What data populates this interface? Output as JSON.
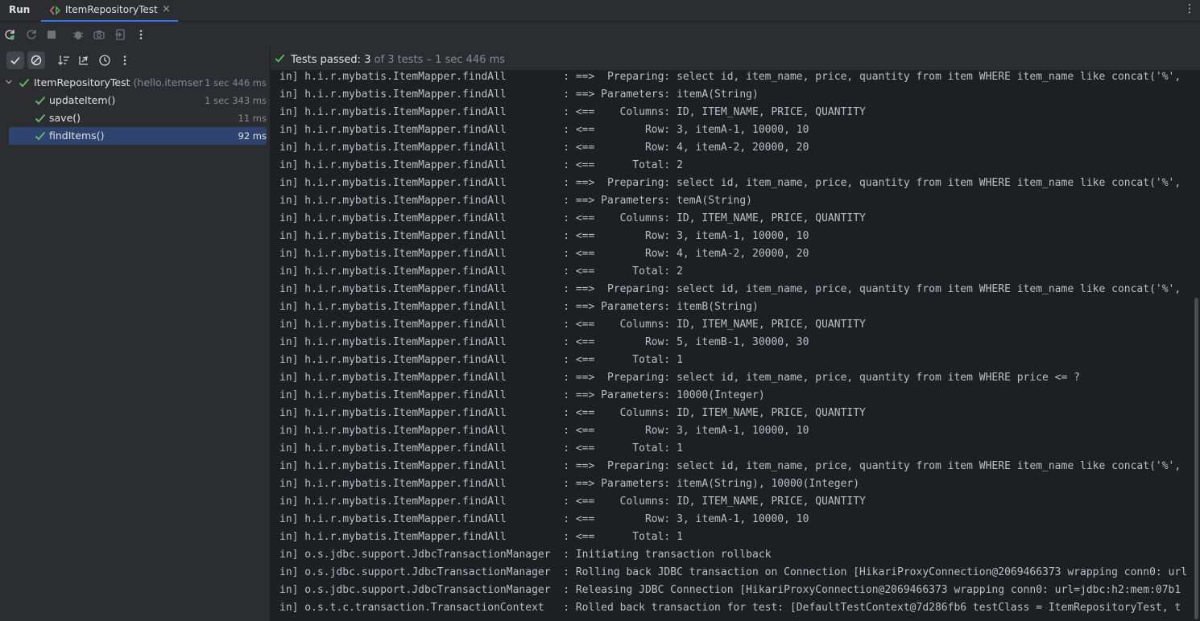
{
  "header": {
    "run_label": "Run",
    "tab_title": "ItemRepositoryTest",
    "tab_close": "×",
    "more_icon": "⋮"
  },
  "toolbar": {
    "icons": [
      "rerun-icon",
      "rerun-failed-icon",
      "stop-icon",
      "debug-icon",
      "screenshot-icon",
      "exit-icon",
      "more-icon"
    ]
  },
  "test_toolbar": {
    "icons": [
      "show-passed-icon",
      "show-ignored-icon",
      "sort-icon",
      "collapse-icon",
      "history-icon",
      "more-icon"
    ]
  },
  "status": {
    "label": "Tests passed:",
    "count": "3",
    "rest": "of 3 tests – 1 sec 446 ms"
  },
  "tree": {
    "root": {
      "name": "ItemRepositoryTest",
      "package": "(hello.itemser",
      "time": "1 sec 446 ms"
    },
    "children": [
      {
        "name": "updateItem()",
        "time": "1 sec 343 ms"
      },
      {
        "name": "save()",
        "time": "11 ms"
      },
      {
        "name": "findItems()",
        "time": "92 ms"
      }
    ]
  },
  "console": {
    "lines": [
      "in] h.i.r.mybatis.ItemMapper.findAll         : ==>  Preparing: select id, item_name, price, quantity from item WHERE item_name like concat('%',",
      "in] h.i.r.mybatis.ItemMapper.findAll         : ==> Parameters: itemA(String)",
      "in] h.i.r.mybatis.ItemMapper.findAll         : <==    Columns: ID, ITEM_NAME, PRICE, QUANTITY",
      "in] h.i.r.mybatis.ItemMapper.findAll         : <==        Row: 3, itemA-1, 10000, 10",
      "in] h.i.r.mybatis.ItemMapper.findAll         : <==        Row: 4, itemA-2, 20000, 20",
      "in] h.i.r.mybatis.ItemMapper.findAll         : <==      Total: 2",
      "in] h.i.r.mybatis.ItemMapper.findAll         : ==>  Preparing: select id, item_name, price, quantity from item WHERE item_name like concat('%',",
      "in] h.i.r.mybatis.ItemMapper.findAll         : ==> Parameters: temA(String)",
      "in] h.i.r.mybatis.ItemMapper.findAll         : <==    Columns: ID, ITEM_NAME, PRICE, QUANTITY",
      "in] h.i.r.mybatis.ItemMapper.findAll         : <==        Row: 3, itemA-1, 10000, 10",
      "in] h.i.r.mybatis.ItemMapper.findAll         : <==        Row: 4, itemA-2, 20000, 20",
      "in] h.i.r.mybatis.ItemMapper.findAll         : <==      Total: 2",
      "in] h.i.r.mybatis.ItemMapper.findAll         : ==>  Preparing: select id, item_name, price, quantity from item WHERE item_name like concat('%',",
      "in] h.i.r.mybatis.ItemMapper.findAll         : ==> Parameters: itemB(String)",
      "in] h.i.r.mybatis.ItemMapper.findAll         : <==    Columns: ID, ITEM_NAME, PRICE, QUANTITY",
      "in] h.i.r.mybatis.ItemMapper.findAll         : <==        Row: 5, itemB-1, 30000, 30",
      "in] h.i.r.mybatis.ItemMapper.findAll         : <==      Total: 1",
      "in] h.i.r.mybatis.ItemMapper.findAll         : ==>  Preparing: select id, item_name, price, quantity from item WHERE price <= ?",
      "in] h.i.r.mybatis.ItemMapper.findAll         : ==> Parameters: 10000(Integer)",
      "in] h.i.r.mybatis.ItemMapper.findAll         : <==    Columns: ID, ITEM_NAME, PRICE, QUANTITY",
      "in] h.i.r.mybatis.ItemMapper.findAll         : <==        Row: 3, itemA-1, 10000, 10",
      "in] h.i.r.mybatis.ItemMapper.findAll         : <==      Total: 1",
      "in] h.i.r.mybatis.ItemMapper.findAll         : ==>  Preparing: select id, item_name, price, quantity from item WHERE item_name like concat('%',",
      "in] h.i.r.mybatis.ItemMapper.findAll         : ==> Parameters: itemA(String), 10000(Integer)",
      "in] h.i.r.mybatis.ItemMapper.findAll         : <==    Columns: ID, ITEM_NAME, PRICE, QUANTITY",
      "in] h.i.r.mybatis.ItemMapper.findAll         : <==        Row: 3, itemA-1, 10000, 10",
      "in] h.i.r.mybatis.ItemMapper.findAll         : <==      Total: 1",
      "in] o.s.jdbc.support.JdbcTransactionManager  : Initiating transaction rollback",
      "in] o.s.jdbc.support.JdbcTransactionManager  : Rolling back JDBC transaction on Connection [HikariProxyConnection@2069466373 wrapping conn0: url",
      "in] o.s.jdbc.support.JdbcTransactionManager  : Releasing JDBC Connection [HikariProxyConnection@2069466373 wrapping conn0: url=jdbc:h2:mem:07b1",
      "in] o.s.t.c.transaction.TransactionContext   : Rolled back transaction for test: [DefaultTestContext@7d286fb6 testClass = ItemRepositoryTest, t"
    ]
  },
  "colors": {
    "accent": "#3574f0",
    "pass_green": "#5fb865",
    "selection": "#2e436e"
  }
}
